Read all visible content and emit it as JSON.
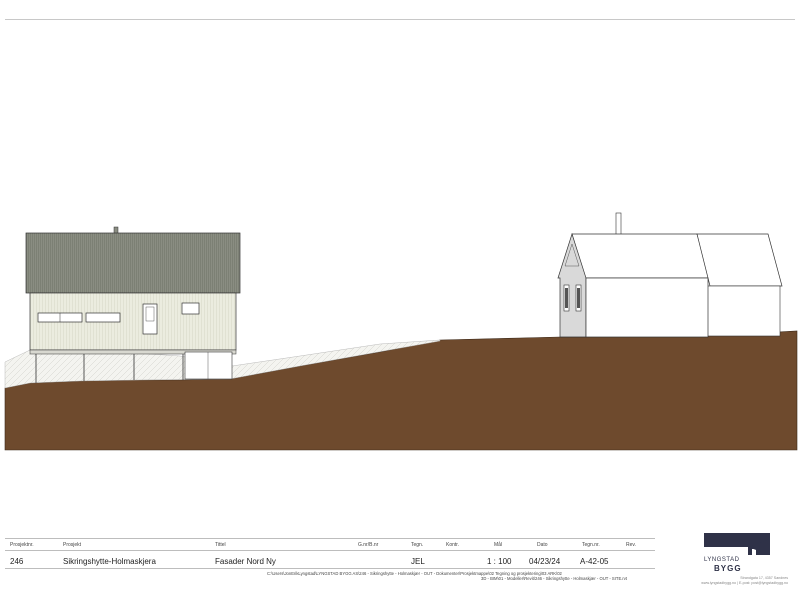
{
  "colors": {
    "ground": "#6e4a2d",
    "roof_left": "#8a8d82",
    "wall_left": "#ebecdf",
    "outline": "#333333",
    "logo": "#2f3248"
  },
  "titleblock": {
    "headers": {
      "prosjektnr": "Prosjektnr.",
      "prosjekt": "Prosjekt",
      "tittel": "Tittel",
      "gnrbnr": "G.nr/B.nr",
      "tegn": "Tegn.",
      "kontr": "Kontr.",
      "maal": "Mål",
      "dato": "Dato",
      "tegnnr": "Tegn.nr.",
      "rev": "Rev."
    },
    "values": {
      "prosjektnr": "246",
      "prosjekt": "Sikringshytte-Holmaskjera",
      "tittel": "Fasader Nord Ny",
      "gnrbnr": "",
      "tegn": "JEL",
      "kontr": "",
      "maal": "1 : 100",
      "dato": "04/23/24",
      "tegnnr": "A-42-05",
      "rev": ""
    },
    "path_line1": "C:\\Users\\JonErikLyngstad\\LYNGSTAD BYGG AS\\246 - Sikringshytte - Holmaskjær - OUT - Dokumenter\\Prosjektmappe\\02 Tegning og prosjektering\\03 ARK\\02",
    "path_line2": "3D - BIM\\01 - Modeller\\Revit\\246 - Sikringshytte - Holmaskjær - OUT - SITE.rvt"
  },
  "logo": {
    "line1": "LYNGSTAD",
    "line2": "BYGG",
    "address1": "Strandgata 17, 4357 Sandnes",
    "address2": "www.lyngstadbygg.no | E-post: post@lyngstadbygg.no"
  }
}
